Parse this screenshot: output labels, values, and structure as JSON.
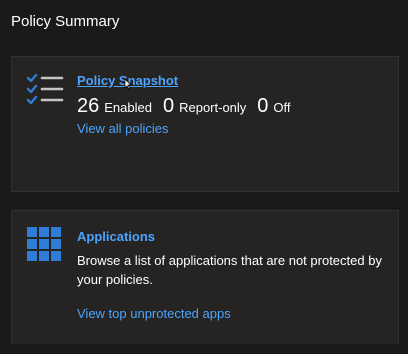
{
  "section_title": "Policy Summary",
  "policy_card": {
    "icon": "checklist-icon",
    "title": "Policy Snapshot",
    "enabled_count": "26",
    "enabled_label": "Enabled",
    "report_only_count": "0",
    "report_only_label": "Report-only",
    "off_count": "0",
    "off_label": "Off",
    "link": "View all policies"
  },
  "apps_card": {
    "icon": "app-grid-icon",
    "title": "Applications",
    "description": "Browse a list of applications that are not protected by your policies.",
    "link": "View top unprotected apps"
  },
  "colors": {
    "background": "#1b1a19",
    "card": "#252423",
    "link": "#4ca4ff",
    "icon_blue": "#2f7dd6"
  }
}
